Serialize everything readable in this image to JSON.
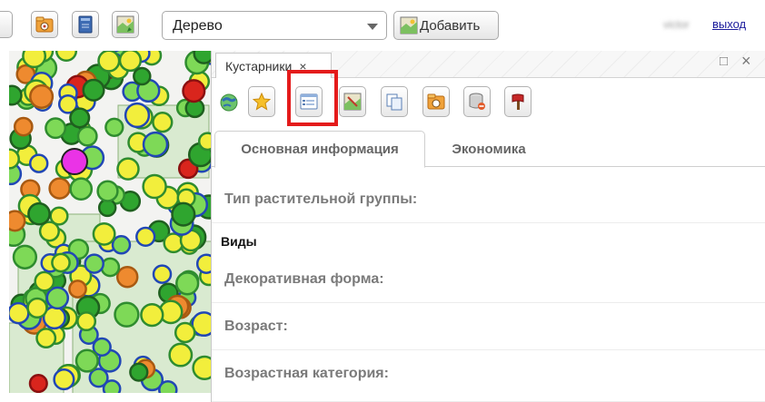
{
  "toolbar": {
    "icons": [
      "partial-button-icon",
      "drawing-folder-icon",
      "book-icon",
      "map-layer-icon"
    ],
    "object_type": {
      "selected": "Дерево"
    },
    "add_button": {
      "label": "Добавить",
      "icon": "add-map-icon"
    },
    "user_name": "victor",
    "logout": "выход"
  },
  "map": {
    "colors": {
      "yellow": "#f2ee3c",
      "light_green": "#7ed957",
      "green": "#2fa52f",
      "blue_outline": "#2147b5",
      "orange": "#ee8a2f",
      "red": "#d9251d",
      "magenta": "#ea33e6"
    }
  },
  "panel": {
    "tab_label": "Кустарники",
    "tab_close": "×",
    "maximize": "□",
    "close": "×",
    "tools": [
      {
        "icon": "globe-icon"
      },
      {
        "icon": "star-icon"
      },
      {
        "icon": "form-info-icon",
        "highlighted": true
      },
      {
        "icon": "map-image-icon"
      },
      {
        "icon": "copy-icon"
      },
      {
        "icon": "folder-icon"
      },
      {
        "icon": "delete-db-icon"
      },
      {
        "icon": "axe-icon"
      }
    ],
    "highlight_color": "#e41b1b",
    "inner_tabs": [
      "Основная информация",
      "Экономика"
    ],
    "fields": [
      "Тип растительной группы:",
      "Декоративная форма:",
      "Возраст:",
      "Возрастная категория:"
    ],
    "section_label": "Виды"
  }
}
